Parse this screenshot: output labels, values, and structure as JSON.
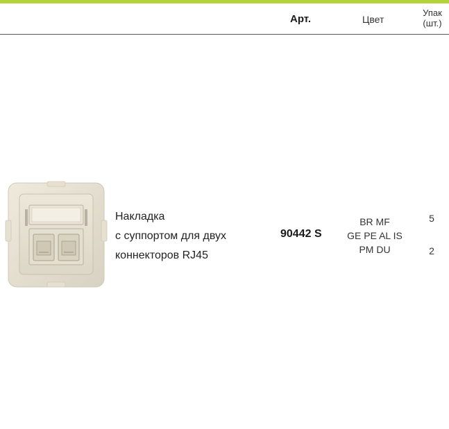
{
  "theme": {
    "accent": "#b5d33a"
  },
  "header": {
    "article_label": "Арт.",
    "color_label": "Цвет",
    "pack_label_line1": "Упак",
    "pack_label_line2": "(шт.)"
  },
  "product": {
    "image_icon": "rj45-dual-faceplate-icon",
    "description_lines": [
      "Накладка",
      "с суппортом для двух",
      "коннекторов RJ45"
    ],
    "article": "90442 S",
    "color_lines": [
      "BR MF",
      "GE PE AL IS",
      "PM DU"
    ],
    "pack_values": [
      "5",
      "2"
    ]
  }
}
